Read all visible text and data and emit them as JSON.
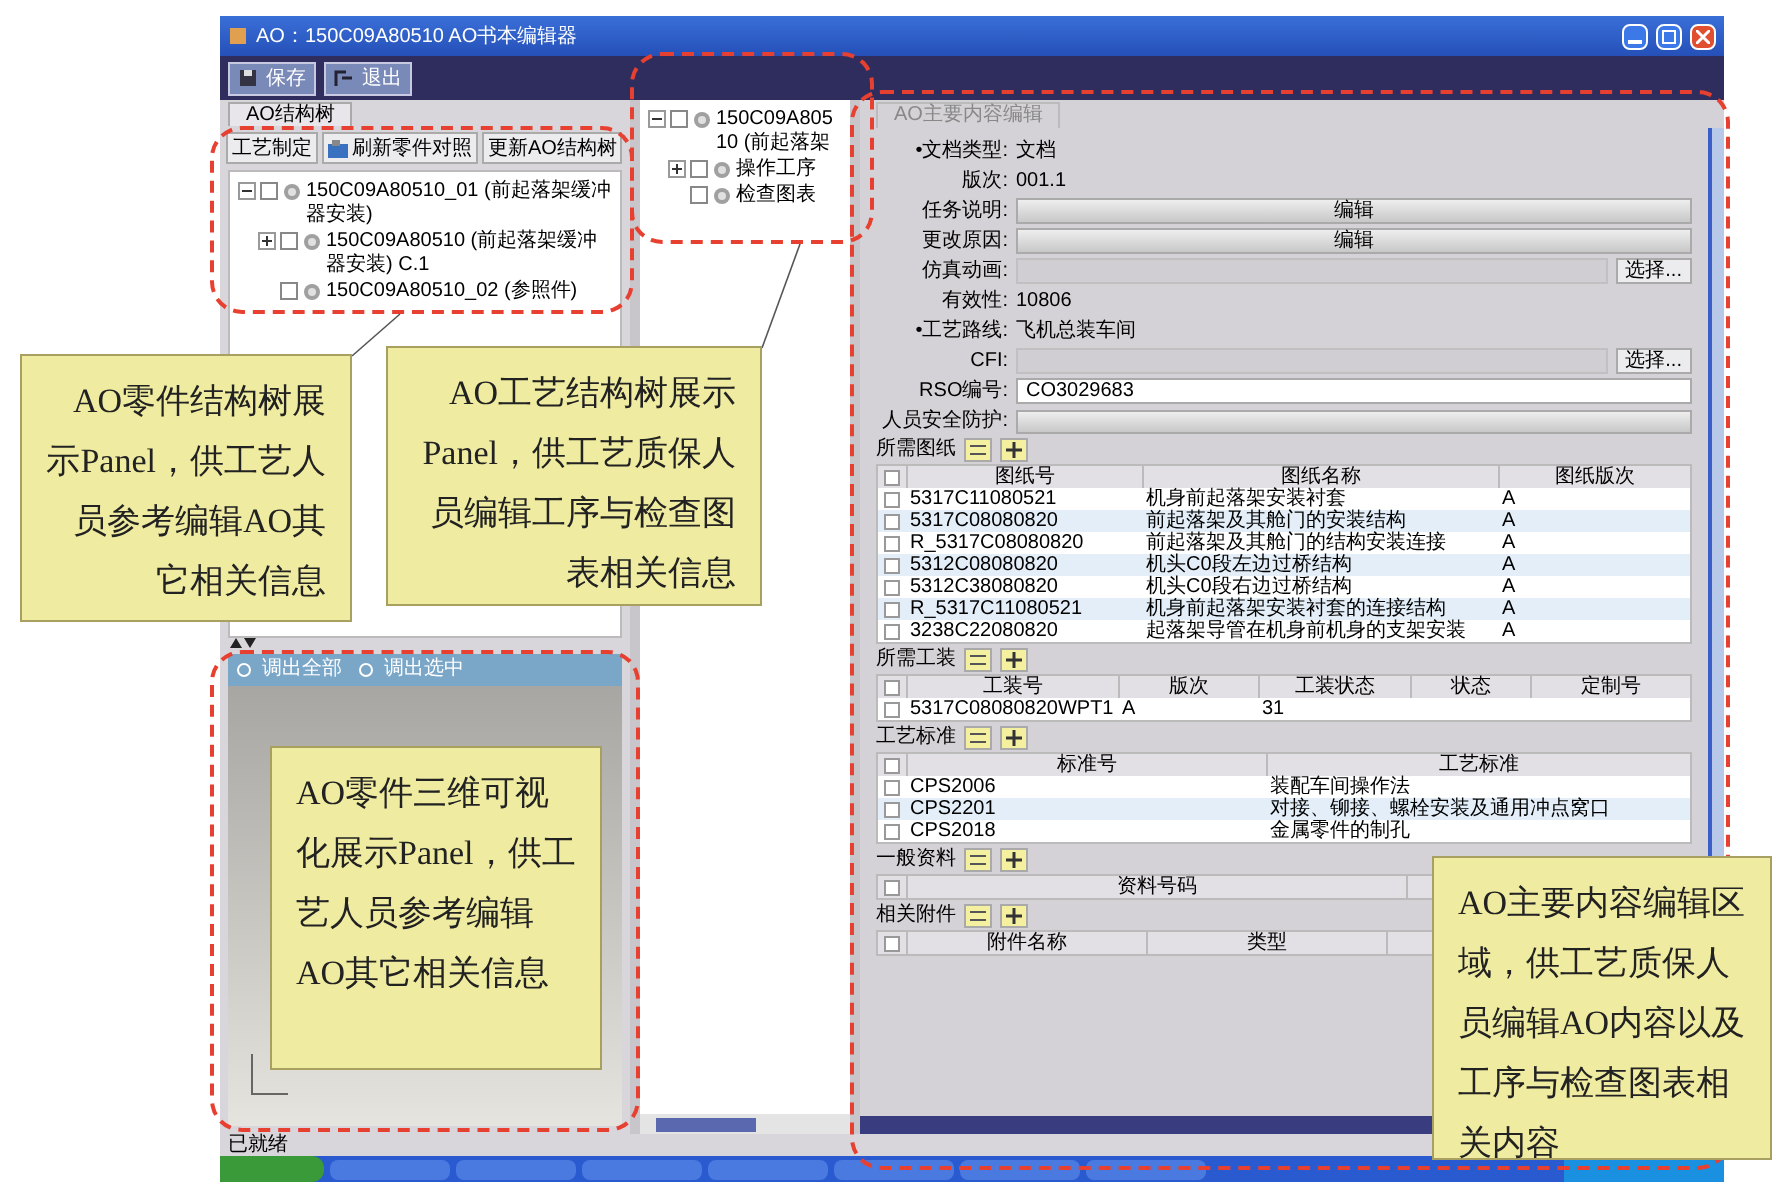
{
  "window": {
    "title": "AO：150C09A80510 AO书本编辑器"
  },
  "toolbar": [
    {
      "label": "保存"
    },
    {
      "label": "退出"
    }
  ],
  "part_tree_panel": {
    "tab": "AO结构树",
    "buttons": [
      "工艺制定",
      "刷新零件对照",
      "更新AO结构树"
    ],
    "tree": [
      {
        "label": "150C09A80510_01 (前起落架缓冲器安装)",
        "expanded": true,
        "checked": false,
        "children": [
          {
            "label": "150C09A80510 (前起落架缓冲器安装) C.1",
            "expanded": false,
            "checked": false
          },
          {
            "label": "150C09A80510_02 (参照件)",
            "checked": false
          }
        ]
      }
    ]
  },
  "viewer": {
    "buttons": [
      "调出全部",
      "调出选中"
    ]
  },
  "process_tree": {
    "tree": [
      {
        "label": "150C09A80510 (前起落架",
        "expanded": true,
        "checked": false,
        "children": [
          {
            "label": "操作工序",
            "expanded": false,
            "checked": false
          },
          {
            "label": "检查图表",
            "checked": false
          }
        ]
      }
    ]
  },
  "editor": {
    "tab": "AO主要内容编辑",
    "fields": [
      {
        "kind": "text",
        "label": "•文档类型:",
        "value": "文档"
      },
      {
        "kind": "text",
        "label": "版次:",
        "value": "001.1"
      },
      {
        "kind": "button",
        "label": "任务说明:",
        "value": "编辑"
      },
      {
        "kind": "button",
        "label": "更改原因:",
        "value": "编辑"
      },
      {
        "kind": "select",
        "label": "仿真动画:",
        "value": "选择..."
      },
      {
        "kind": "text",
        "label": "有效性:",
        "value": "10806"
      },
      {
        "kind": "text",
        "label": "•工艺路线:",
        "value": "飞机总装车间"
      },
      {
        "kind": "select",
        "label": "CFI:",
        "value": "选择..."
      },
      {
        "kind": "input",
        "label": "RSO编号:",
        "value": "CO3029683"
      },
      {
        "kind": "bar",
        "label": "人员安全防护:"
      }
    ],
    "sections": [
      {
        "title": "所需图纸",
        "select_all": false,
        "columns": [
          "图纸号",
          "图纸名称",
          "图纸版次"
        ],
        "rows": [
          {
            "checked": false,
            "cells": [
              "5317C11080521",
              "机身前起落架安装衬套",
              "A"
            ]
          },
          {
            "checked": false,
            "cells": [
              "5317C08080820",
              "前起落架及其舱门的安装结构",
              "A"
            ]
          },
          {
            "checked": false,
            "cells": [
              "R_5317C08080820",
              "前起落架及其舱门的结构安装连接",
              "A"
            ]
          },
          {
            "checked": false,
            "cells": [
              "5312C08080820",
              "机头C0段左边过桥结构",
              "A"
            ]
          },
          {
            "checked": false,
            "cells": [
              "5312C38080820",
              "机头C0段右边过桥结构",
              "A"
            ]
          },
          {
            "checked": false,
            "cells": [
              "R_5317C11080521",
              "机身前起落架安装衬套的连接结构",
              "A"
            ]
          },
          {
            "checked": false,
            "cells": [
              "3238C22080820",
              "起落架导管在机身前机身的支架安装",
              "A"
            ]
          }
        ]
      },
      {
        "title": "所需工装",
        "select_all": false,
        "columns": [
          "工装号",
          "版次",
          "工装状态",
          "状态",
          "定制号"
        ],
        "rows": [
          {
            "checked": false,
            "cells": [
              "5317C08080820WPT1",
              "A",
              "31",
              "",
              ""
            ]
          }
        ]
      },
      {
        "title": "工艺标准",
        "select_all": false,
        "columns": [
          "标准号",
          "工艺标准"
        ],
        "rows": [
          {
            "checked": false,
            "cells": [
              "CPS2006",
              "装配车间操作法"
            ]
          },
          {
            "checked": false,
            "cells": [
              "CPS2201",
              "对接、铆接、螺栓安装及通用冲点窝口"
            ]
          },
          {
            "checked": false,
            "cells": [
              "CPS2018",
              "金属零件的制孔"
            ]
          }
        ]
      },
      {
        "title": "一般资料",
        "select_all": false,
        "columns": [
          "资料号码"
        ]
      },
      {
        "title": "相关附件",
        "select_all": false,
        "columns": [
          "附件名称",
          "类型"
        ]
      }
    ]
  },
  "status_bar": "已就绪",
  "callouts": [
    {
      "text": "AO零件结构树展示Panel，供工艺人员参考编辑AO其它相关信息"
    },
    {
      "text": "AO工艺结构树展示Panel，供工艺质保人员编辑工序与检查图表相关信息"
    },
    {
      "text": "AO零件三维可视化展示Panel，供工艺人员参考编辑AO其它相关信息"
    },
    {
      "text": "AO主要内容编辑区域，供工艺质保人员编辑AO内容以及工序与检查图表相关内容"
    }
  ]
}
